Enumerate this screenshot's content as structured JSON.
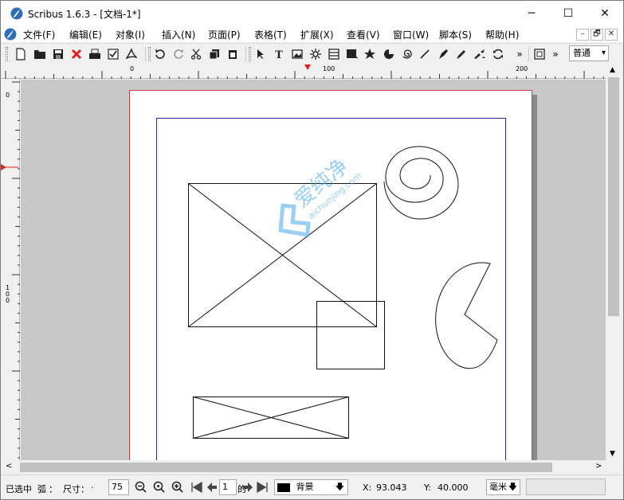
{
  "window": {
    "title": "Scribus 1.6.3 - [文档-1*]",
    "controls": {
      "minimize": "─",
      "maximize": "☐",
      "close": "✕"
    }
  },
  "menubar": {
    "items": [
      "文件(F)",
      "编辑(E)",
      "对象(I)",
      "插入(N)",
      "页面(P)",
      "表格(T)",
      "扩展(X)",
      "查看(V)",
      "窗口(W)",
      "脚本(S)",
      "帮助(H)"
    ],
    "mdi_controls": {
      "minimize": "–",
      "restore": "🗗",
      "close": "✕"
    }
  },
  "toolbar": {
    "icons": [
      "new-document-icon",
      "open-folder-icon",
      "save-icon",
      "close-document-icon",
      "print-icon",
      "preflight-check-icon",
      "export-pdf-icon",
      "undo-icon",
      "redo-icon",
      "cut-icon",
      "copy-icon",
      "paste-icon",
      "select-icon",
      "text-frame-icon",
      "image-frame-icon",
      "render-frame-icon",
      "table-icon",
      "shape-icon",
      "polygon-icon",
      "arc-icon",
      "spiral-icon",
      "line-icon",
      "bezier-icon",
      "freehand-icon",
      "rotate-icon",
      "link-frames-icon"
    ],
    "overflow": "»",
    "style_value": "普通"
  },
  "rulers": {
    "h_labels": [
      "0",
      "100",
      "200"
    ],
    "v_labels": [
      "0",
      "1",
      "0",
      "0"
    ]
  },
  "watermark": {
    "text_cn": "爱纯净",
    "text_en": "aichunjing.com"
  },
  "statusbar": {
    "selection": "已选中",
    "shape": "弧",
    "colon": "：",
    "size_label": "尺寸",
    "dot": "·",
    "zoom": "75",
    "page_number": "1",
    "page_of": "的",
    "layer": "背景",
    "x_label": "X:",
    "x_value": "93.043",
    "y_label": "Y:",
    "y_value": "40.000",
    "unit": "毫米"
  }
}
